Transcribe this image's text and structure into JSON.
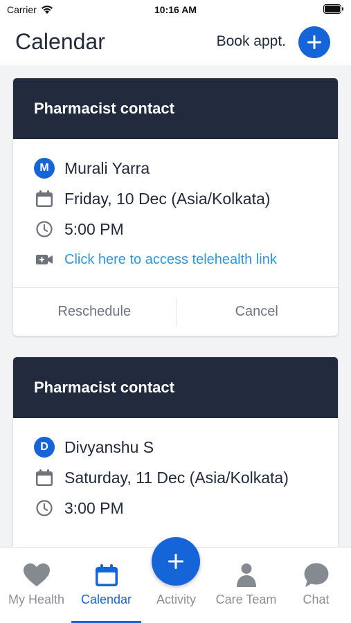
{
  "status_bar": {
    "carrier": "Carrier",
    "time": "10:16 AM"
  },
  "header": {
    "title": "Calendar",
    "book_label": "Book appt."
  },
  "appointments": [
    {
      "title": "Pharmacist contact",
      "avatar_initial": "M",
      "name": "Murali Yarra",
      "date": "Friday, 10 Dec (Asia/Kolkata)",
      "time": "5:00 PM",
      "link_text": "Click here to access telehealth link",
      "reschedule_label": "Reschedule",
      "cancel_label": "Cancel"
    },
    {
      "title": "Pharmacist contact",
      "avatar_initial": "D",
      "name": "Divyanshu S",
      "date": "Saturday, 11 Dec (Asia/Kolkata)",
      "time": "3:00 PM"
    }
  ],
  "tabs": [
    {
      "label": "My Health",
      "icon": "heart-icon"
    },
    {
      "label": "Calendar",
      "icon": "calendar-icon",
      "active": true
    },
    {
      "label": "Activity",
      "icon": "plus-icon"
    },
    {
      "label": "Care Team",
      "icon": "person-icon"
    },
    {
      "label": "Chat",
      "icon": "chat-bubble-icon"
    }
  ],
  "colors": {
    "accent": "#1565d8",
    "card_header": "#222b3d",
    "link": "#2f95dc",
    "muted": "#8a8f97"
  }
}
